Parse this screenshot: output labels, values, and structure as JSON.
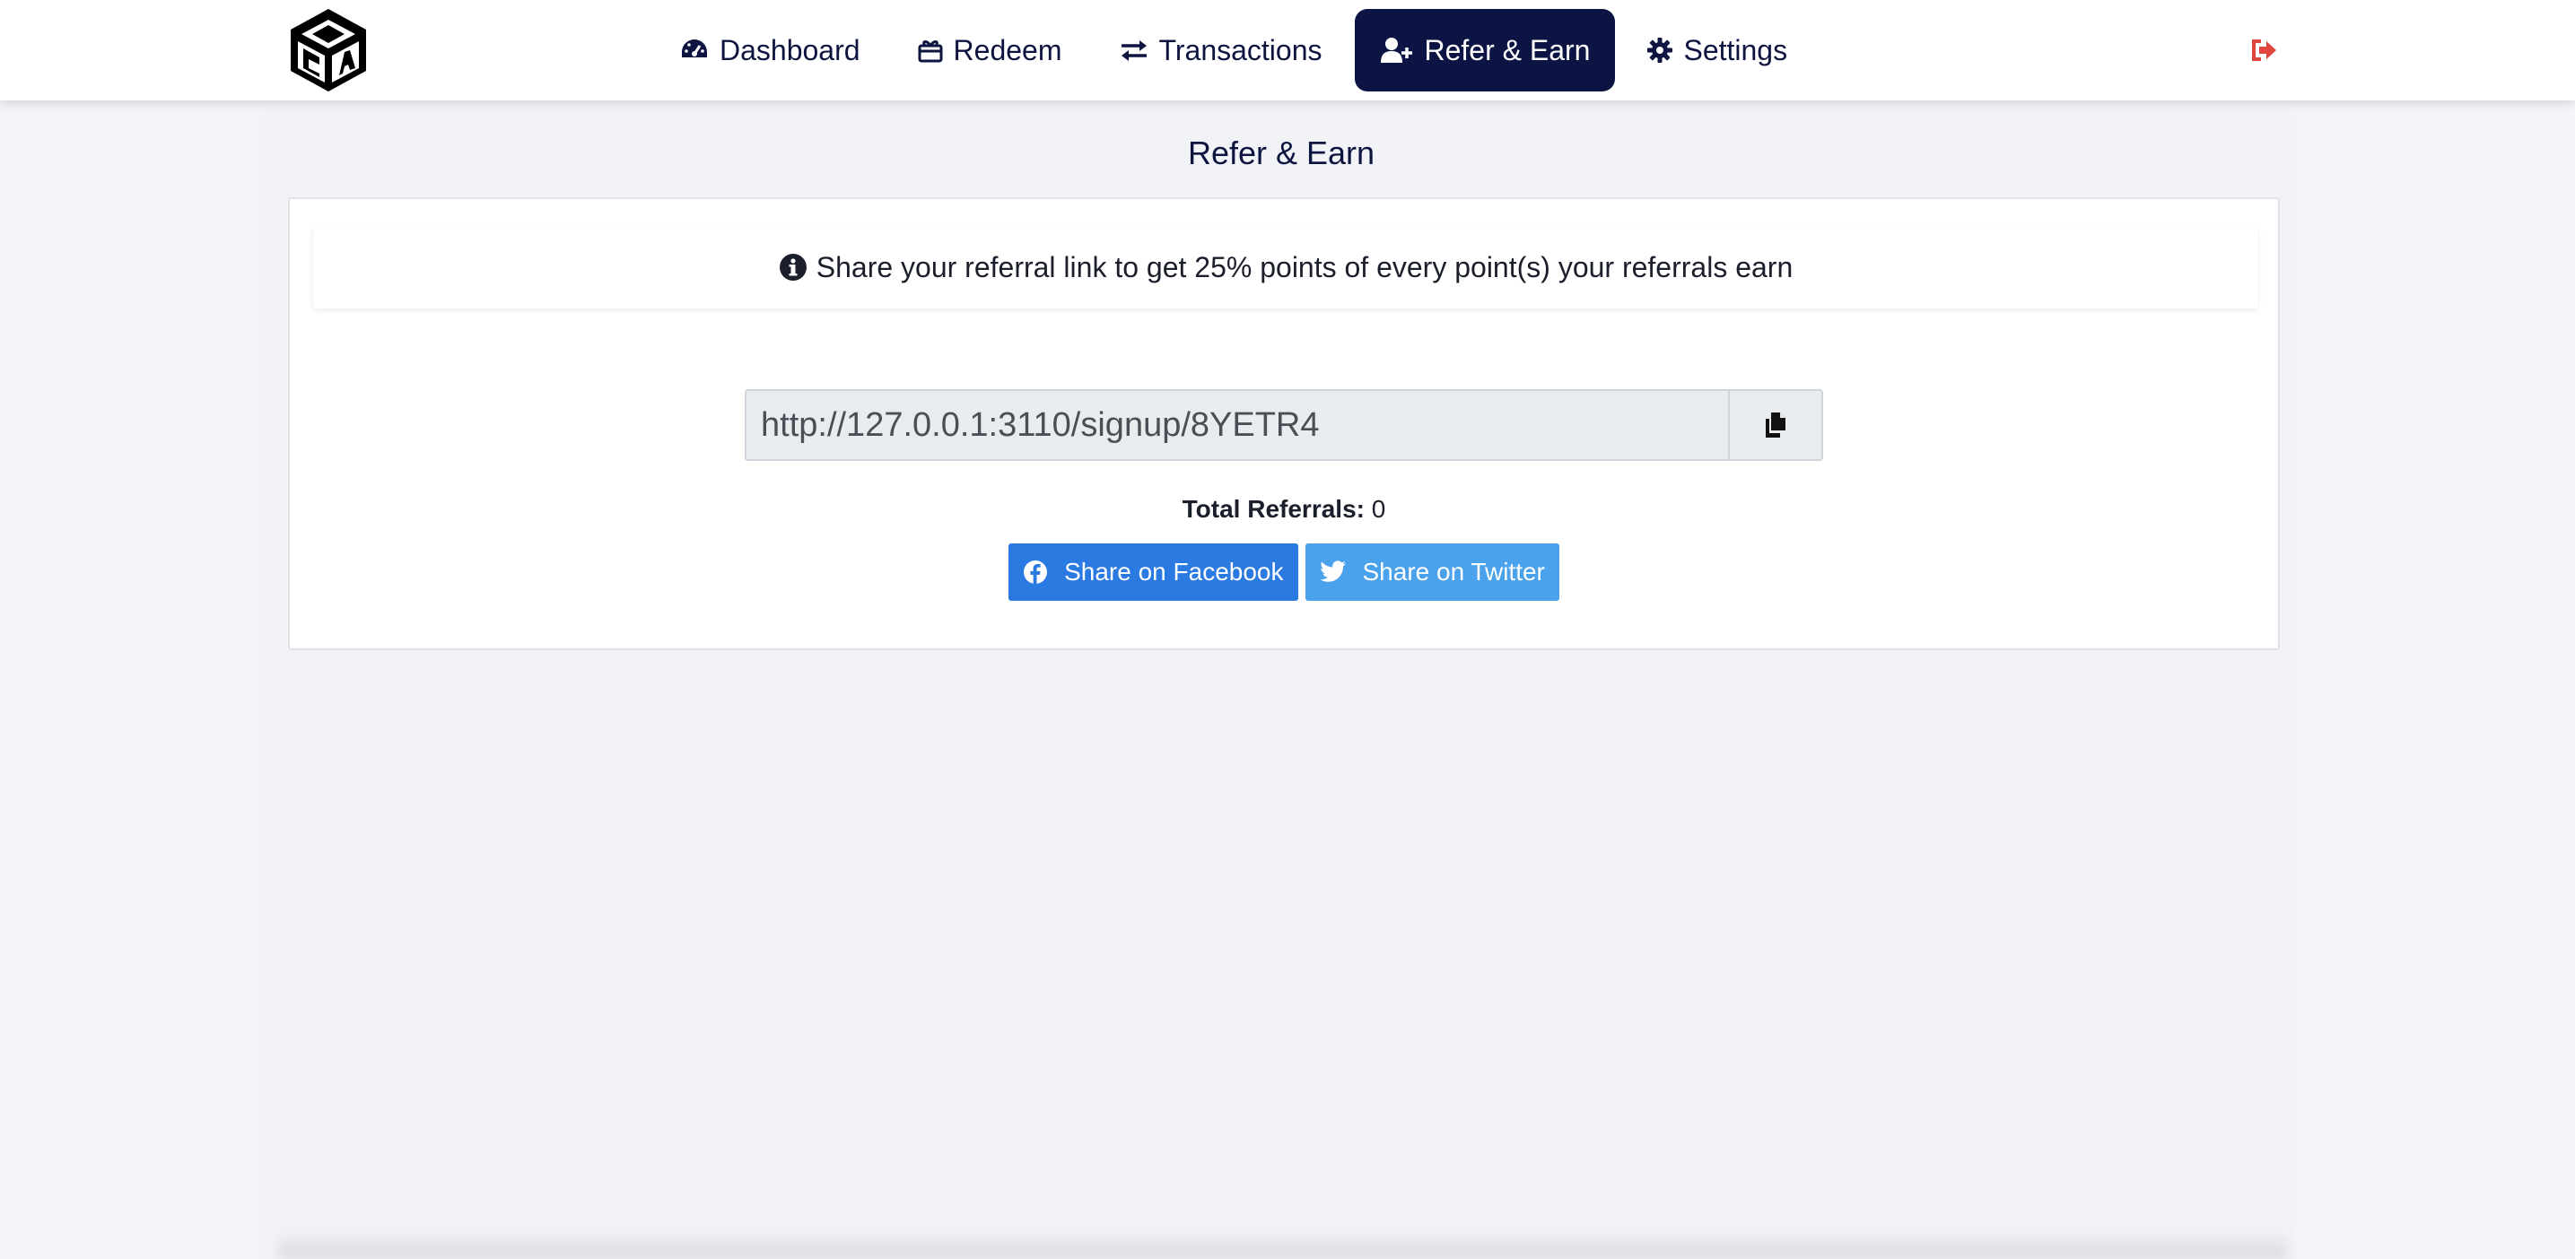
{
  "nav": {
    "items": [
      {
        "label": "Dashboard",
        "icon": "dashboard-gauge-icon",
        "active": false
      },
      {
        "label": "Redeem",
        "icon": "redeem-gift-icon",
        "active": false
      },
      {
        "label": "Transactions",
        "icon": "exchange-arrows-icon",
        "active": false
      },
      {
        "label": "Refer & Earn",
        "icon": "user-plus-icon",
        "active": true
      },
      {
        "label": "Settings",
        "icon": "gear-icon",
        "active": false
      }
    ],
    "logout_icon": "sign-out-icon"
  },
  "colors": {
    "nav_active_bg": "#0b1442",
    "nav_text": "#0d1440",
    "logout": "#e0463e",
    "facebook": "#2a7ae2",
    "twitter": "#4aa1ec"
  },
  "page": {
    "title": "Refer & Earn"
  },
  "referral": {
    "info": "Share your referral link to get 25% points of every point(s) your referrals earn",
    "link": "http://127.0.0.1:3110/signup/8YETR4",
    "total_label": "Total Referrals:",
    "total_value": "0",
    "share_facebook": "Share on Facebook",
    "share_twitter": "Share on Twitter"
  }
}
